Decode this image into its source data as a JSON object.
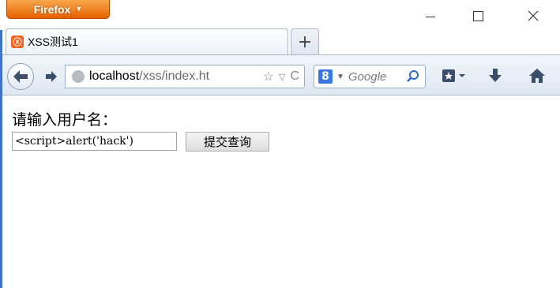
{
  "window": {
    "app_button_label": "Firefox",
    "accent_color": "#e66000",
    "frame_color": "#3f74c7"
  },
  "tabs": [
    {
      "title": "XSS测试1",
      "favicon": "xampp-icon"
    }
  ],
  "navbar": {
    "url_host": "localhost",
    "url_path": "/xss/index.ht",
    "search_placeholder": "Google",
    "search_engine_icon": "g-icon"
  },
  "page": {
    "prompt": "请输入用户名：",
    "username_value": "<script>alert('hack')",
    "submit_label": "提交查询"
  }
}
